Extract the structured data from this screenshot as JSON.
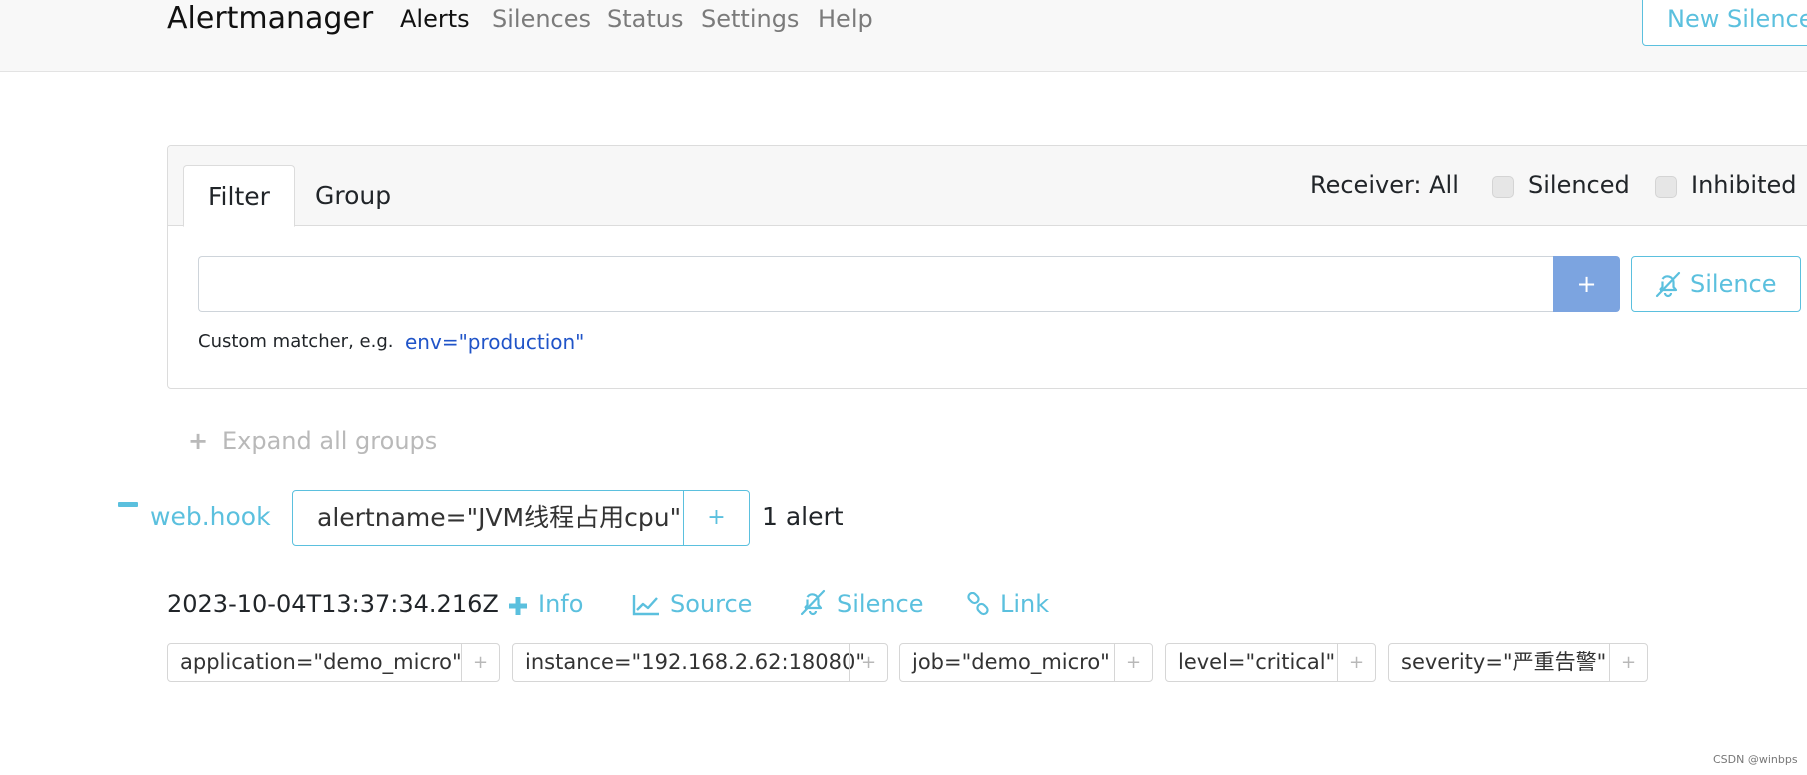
{
  "navbar": {
    "brand": "Alertmanager",
    "links": [
      {
        "label": "Alerts",
        "active": true
      },
      {
        "label": "Silences",
        "active": false
      },
      {
        "label": "Status",
        "active": false
      },
      {
        "label": "Settings",
        "active": false
      },
      {
        "label": "Help",
        "active": false
      }
    ],
    "new_silence": "New Silence"
  },
  "filter_card": {
    "tabs": [
      {
        "label": "Filter",
        "active": true
      },
      {
        "label": "Group",
        "active": false
      }
    ],
    "receiver": "Receiver: All",
    "checkboxes": [
      {
        "label": "Silenced",
        "checked": false
      },
      {
        "label": "Inhibited",
        "checked": false
      }
    ],
    "input_value": "",
    "add_button": "+",
    "silence_button": "Silence",
    "hint_text": "Custom matcher, e.g.",
    "hint_example": "env=\"production\""
  },
  "expand_all": {
    "icon": "+",
    "label": "Expand all groups"
  },
  "group": {
    "collapse_icon": "minus-icon",
    "receiver": "web.hook",
    "label": "alertname=\"JVM线程占用cpu\"",
    "label_add": "+",
    "count": "1 alert"
  },
  "alert": {
    "timestamp": "2023-10-04T13:37:34.216Z",
    "actions": {
      "info": "Info",
      "source": "Source",
      "silence": "Silence",
      "link": "Link"
    },
    "labels": [
      {
        "text": "application=\"demo_micro\"",
        "add": "+"
      },
      {
        "text": "instance=\"192.168.2.62:18080\"",
        "add": "+"
      },
      {
        "text": "job=\"demo_micro\"",
        "add": "+"
      },
      {
        "text": "level=\"critical\"",
        "add": "+"
      },
      {
        "text": "severity=\"严重告警\"",
        "add": "+"
      }
    ]
  },
  "watermark": "CSDN @winbps",
  "colors": {
    "accent": "#5bc0de",
    "add_button": "#7ca4e0",
    "hint_code": "#2054c8",
    "muted": "#b9b9b9"
  }
}
